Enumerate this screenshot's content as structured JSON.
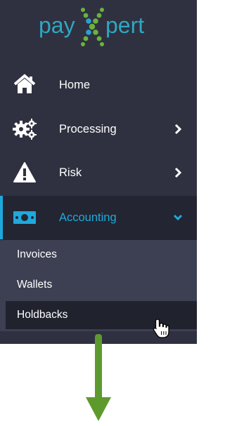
{
  "brand": {
    "logo_text_left": "pay",
    "logo_text_right": "pert",
    "colors": {
      "text": "#2ea7c2",
      "x_green": "#6ab33c",
      "x_blue": "#2a9fd6"
    }
  },
  "colors": {
    "sidebar_bg": "#2f3140",
    "active_bg": "#232532",
    "accent": "#1ea9dc",
    "submenu_bg": "#3d4052",
    "hover_bg": "#20222e",
    "arrow": "#5d9a2e"
  },
  "nav": {
    "items": [
      {
        "label": "Home",
        "icon": "home-icon",
        "has_chevron": false
      },
      {
        "label": "Processing",
        "icon": "gears-icon",
        "has_chevron": true,
        "chevron": "chevron-right-icon"
      },
      {
        "label": "Risk",
        "icon": "warning-icon",
        "has_chevron": true,
        "chevron": "chevron-right-icon"
      },
      {
        "label": "Accounting",
        "icon": "money-icon",
        "has_chevron": true,
        "chevron": "chevron-down-icon",
        "active": true
      }
    ]
  },
  "submenu": {
    "items": [
      {
        "label": "Invoices"
      },
      {
        "label": "Wallets"
      },
      {
        "label": "Holdbacks",
        "hovered": true
      }
    ]
  },
  "annotation": {
    "arrow": "down-arrow-icon",
    "cursor": "hand-pointer-icon"
  }
}
